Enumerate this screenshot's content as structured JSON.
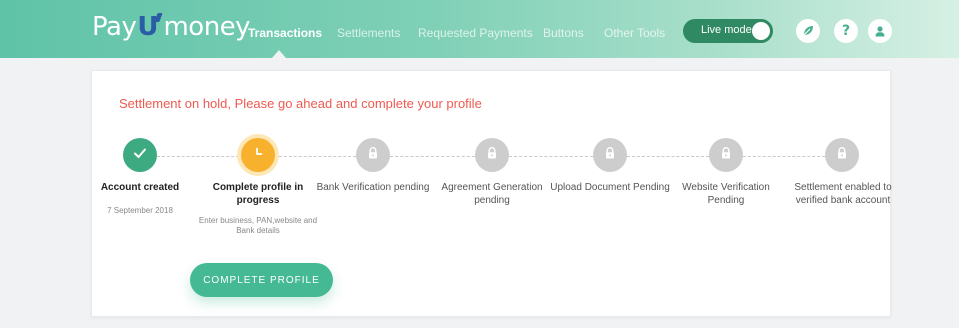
{
  "header": {
    "logo": {
      "part1": "Pay",
      "part2": "U",
      "part3": "money"
    },
    "nav": [
      {
        "label": "Transactions",
        "active": true
      },
      {
        "label": "Settlements",
        "active": false
      },
      {
        "label": "Requested Payments",
        "active": false
      },
      {
        "label": "Buttons",
        "active": false
      },
      {
        "label": "Other Tools",
        "active": false
      }
    ],
    "live_mode": {
      "label": "Live mode",
      "on": true
    },
    "icons": [
      "leaf-icon",
      "help-icon",
      "user-icon"
    ],
    "help_glyph": "?"
  },
  "alert": {
    "text": "Settlement on hold, Please go ahead and complete your profile",
    "color": "#ef5a51"
  },
  "steps": [
    {
      "title": "Account created",
      "subtitle": "7 September 2018",
      "status": "done",
      "icon": "check-icon"
    },
    {
      "title": "Complete profile in progress",
      "subtitle": "Enter business, PAN,website and Bank details",
      "status": "active",
      "icon": "clock-icon"
    },
    {
      "title": "Bank Verification pending",
      "subtitle": "",
      "status": "locked",
      "icon": "lock-icon"
    },
    {
      "title": "Agreement Generation pending",
      "subtitle": "",
      "status": "locked",
      "icon": "lock-icon"
    },
    {
      "title": "Upload Document Pending",
      "subtitle": "",
      "status": "locked",
      "icon": "lock-icon"
    },
    {
      "title": "Website Verification Pending",
      "subtitle": "",
      "status": "locked",
      "icon": "lock-icon"
    },
    {
      "title": "Settlement enabled to verified bank account",
      "subtitle": "",
      "status": "locked",
      "icon": "lock-icon"
    }
  ],
  "cta": {
    "label": "COMPLETE PROFILE"
  },
  "colors": {
    "brand_green": "#45b993",
    "done": "#3daa82",
    "active": "#f7b12c",
    "locked": "#cdcdcd",
    "alert": "#ef5a51",
    "logo_blue": "#2b5ca6"
  }
}
